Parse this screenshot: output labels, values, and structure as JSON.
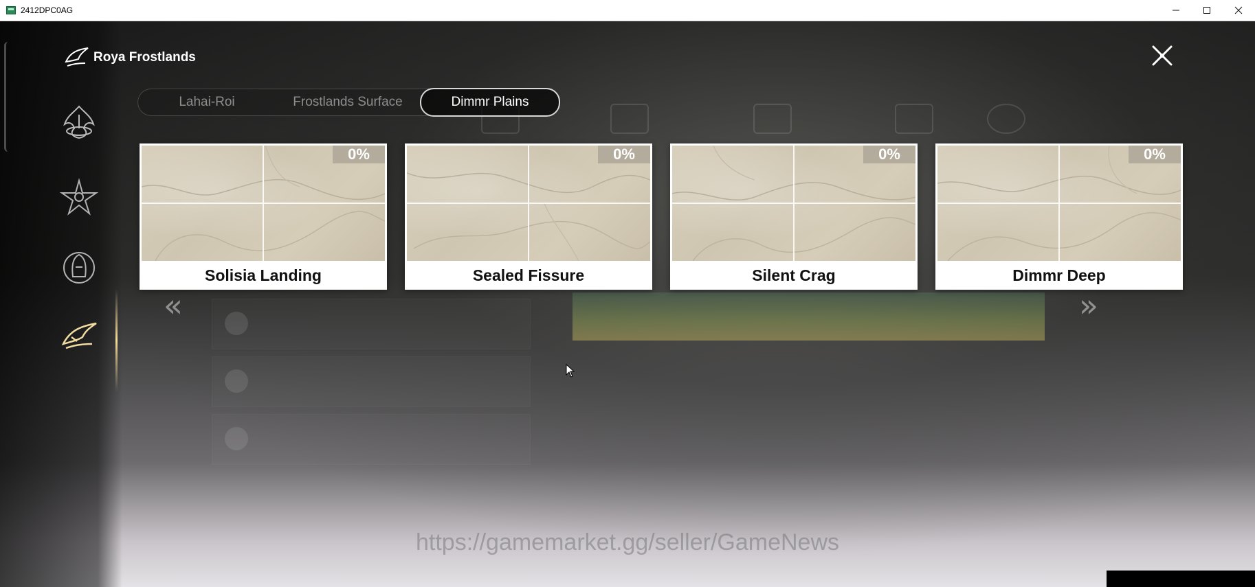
{
  "window": {
    "title": "2412DPC0AG"
  },
  "header": {
    "region_name": "Roya Frostlands"
  },
  "tabs": [
    {
      "label": "Lahai-Roi",
      "selected": false
    },
    {
      "label": "Frostlands Surface",
      "selected": false
    },
    {
      "label": "Dimmr Plains",
      "selected": true
    }
  ],
  "cards": [
    {
      "name": "Solisia Landing",
      "percent": "0%"
    },
    {
      "name": "Sealed Fissure",
      "percent": "0%"
    },
    {
      "name": "Silent Crag",
      "percent": "0%"
    },
    {
      "name": "Dimmr Deep",
      "percent": "0%"
    }
  ],
  "sidebar": {
    "icons": [
      "serpent-emblem-icon",
      "star-emblem-icon",
      "hooded-figure-emblem-icon",
      "bird-emblem-icon"
    ],
    "active_index": 3
  },
  "icons": {
    "close": "close-x-icon",
    "prev": "double-chevron-left-icon",
    "next": "double-chevron-right-icon"
  },
  "watermark": "https://gamemarket.gg/seller/GameNews",
  "colors": {
    "card_bg": "#ffffff",
    "percent_badge": "#b3ab9b",
    "active_tab_border": "#d9d9d9",
    "inactive_tab_text": "#8e8e8e",
    "accent_gold": "#f4dc9a"
  }
}
